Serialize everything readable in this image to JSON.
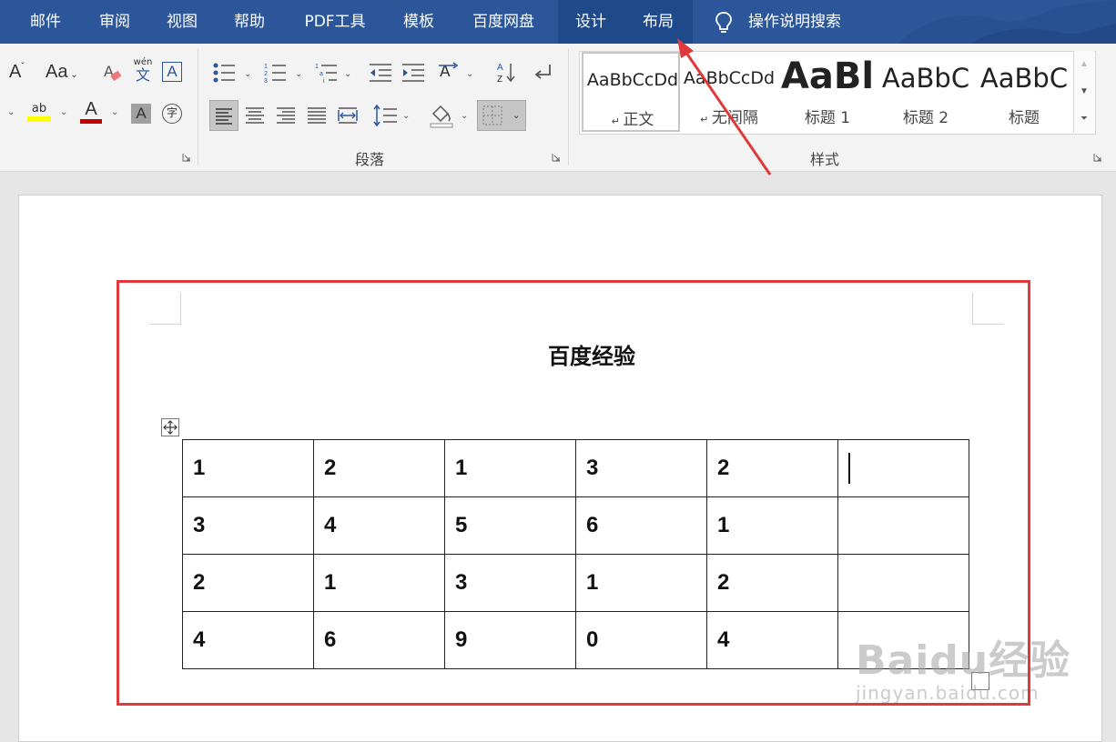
{
  "tabs": [
    {
      "label": "邮件"
    },
    {
      "label": "审阅"
    },
    {
      "label": "视图"
    },
    {
      "label": "帮助"
    },
    {
      "label": "PDF工具"
    },
    {
      "label": "模板"
    },
    {
      "label": "百度网盘"
    },
    {
      "label": "设计"
    },
    {
      "label": "布局"
    }
  ],
  "tell_me": "操作说明搜索",
  "ribbon": {
    "font_group": {
      "aa_label": "Aa",
      "pinyin_label": "wén",
      "pinyin_char": "文",
      "border_char": "A",
      "phonetic_char": "字"
    },
    "paragraph_group": {
      "label": "段落"
    },
    "styles_group": {
      "label": "样式",
      "items": [
        {
          "sample": "AaBbCcDd",
          "name": "正文"
        },
        {
          "sample": "AaBbCcDd",
          "name": "无间隔"
        },
        {
          "sample": "AaBl",
          "name": "标题 1"
        },
        {
          "sample": "AaBbC",
          "name": "标题 2"
        },
        {
          "sample": "AaBbC",
          "name": "标题"
        }
      ]
    }
  },
  "document": {
    "title": "百度经验",
    "table": [
      [
        "1",
        "2",
        "1",
        "3",
        "2",
        ""
      ],
      [
        "3",
        "4",
        "5",
        "6",
        "1",
        ""
      ],
      [
        "2",
        "1",
        "3",
        "1",
        "2",
        ""
      ],
      [
        "4",
        "6",
        "9",
        "0",
        "4",
        ""
      ]
    ]
  },
  "watermark": {
    "main": "Baidu经验",
    "sub": "jingyan.baidu.com"
  },
  "colors": {
    "tabbar": "#2b579a",
    "highlight": "#e0393b",
    "highlight_yellow": "#ffff00",
    "font_red": "#c00000"
  }
}
